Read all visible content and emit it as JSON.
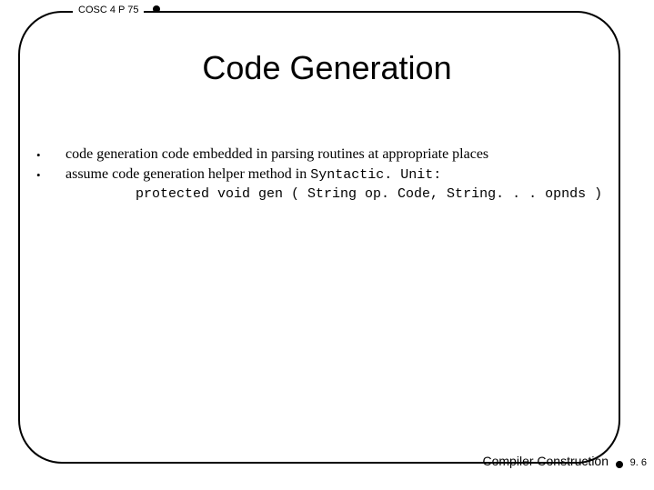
{
  "course": "COSC 4 P 75",
  "title": "Code Generation",
  "bullets": [
    {
      "marker": "•",
      "text": "code generation code embedded in parsing routines at appropriate places"
    },
    {
      "marker": "•",
      "text_prefix": "assume code generation helper method in ",
      "text_mono": "Syntactic. Unit:"
    }
  ],
  "code_line": "   protected void gen ( String op. Code, String. . . opnds )",
  "footer": "Compiler Construction",
  "page": "9. 6"
}
